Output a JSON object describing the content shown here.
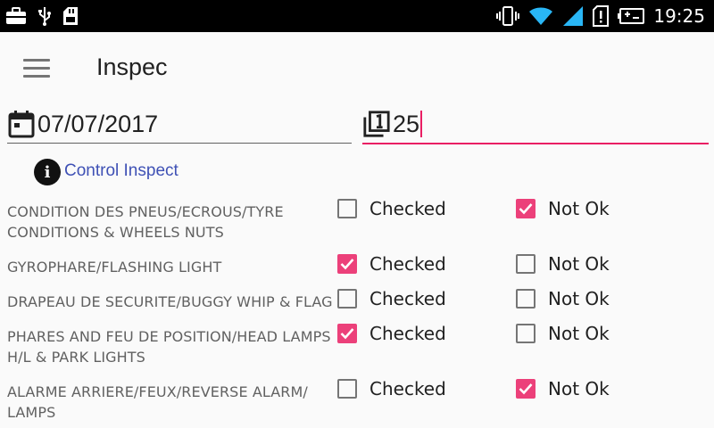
{
  "status_bar": {
    "time": "19:25",
    "left_icons": [
      "briefcase-icon",
      "usb-icon",
      "sd-card-icon"
    ],
    "right_icons": [
      "vibrate-icon",
      "wifi-icon",
      "signal-icon",
      "alert-icon",
      "battery-icon"
    ]
  },
  "app_bar": {
    "title": "Inspec",
    "menu_icon": "menu-icon"
  },
  "form": {
    "date": "07/07/2017",
    "number": "25"
  },
  "info_link": "Control Inspect",
  "colors": {
    "accent": "#e91e63",
    "checkbox_on": "#ec407a",
    "link": "#3f51b5"
  },
  "options": {
    "checked_label": "Checked",
    "notok_label": "Not Ok"
  },
  "items": [
    {
      "label": "CONDITION DES PNEUS/ECROUS/TYRE CONDITIONS & WHEELS NUTS",
      "checked": false,
      "not_ok": true
    },
    {
      "label": "GYROPHARE/FLASHING LIGHT",
      "checked": true,
      "not_ok": false
    },
    {
      "label": "DRAPEAU DE SECURITE/BUGGY WHIP & FLAG",
      "checked": false,
      "not_ok": false
    },
    {
      "label": "PHARES AND FEU DE POSITION/HEAD LAMPS H/L & PARK LIGHTS",
      "checked": true,
      "not_ok": false
    },
    {
      "label": "ALARME ARRIERE/FEUX/REVERSE ALARM/ LAMPS",
      "checked": false,
      "not_ok": true
    }
  ]
}
